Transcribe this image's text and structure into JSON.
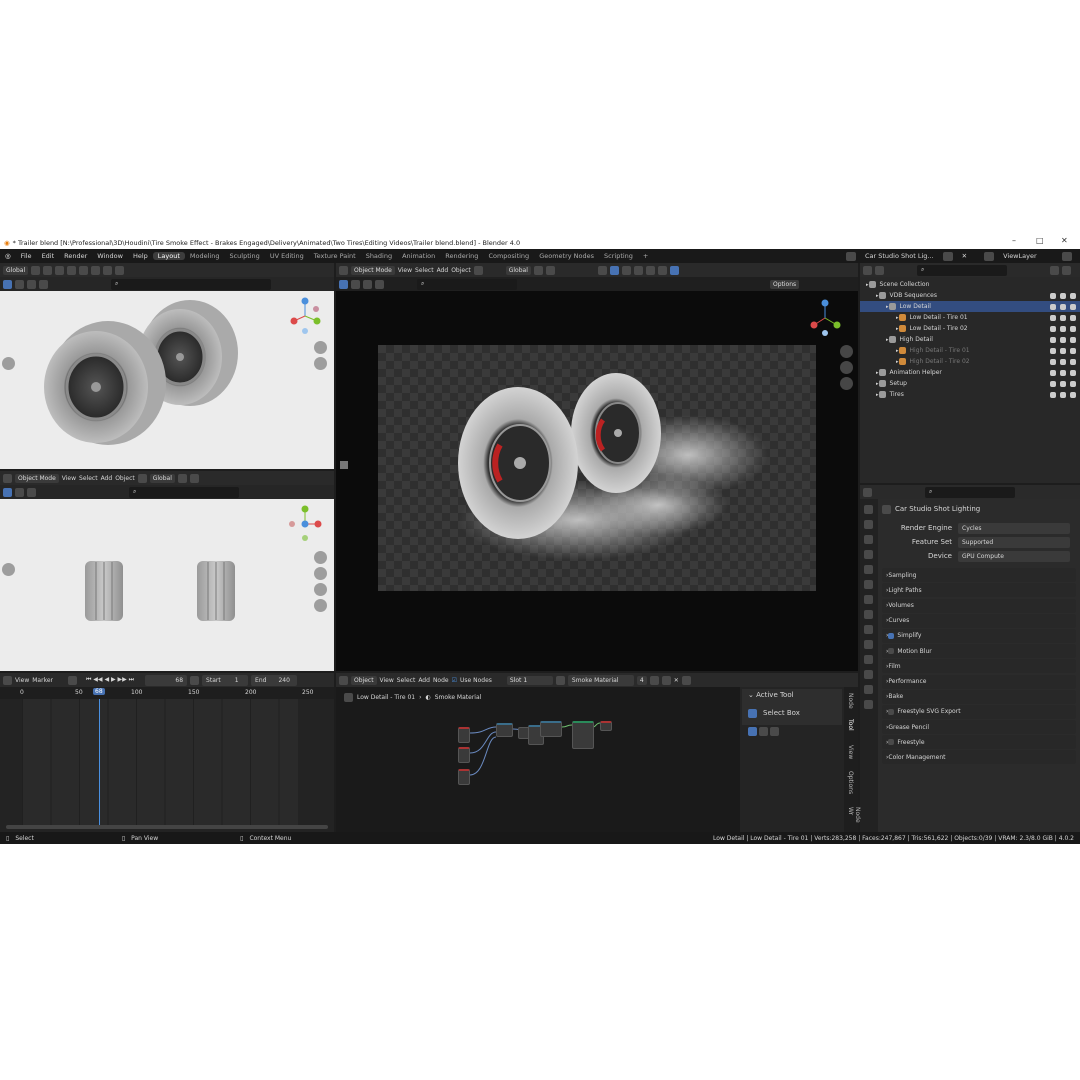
{
  "window": {
    "title": "* Trailer blend [N:\\Professional\\3D\\Houdini\\Tire Smoke Effect - Brakes Engaged\\Delivery\\Animated\\Two Tires\\Editing Videos\\Trailer blend.blend] - Blender 4.0",
    "min": "–",
    "max": "□",
    "close": "✕"
  },
  "menu": [
    "File",
    "Edit",
    "Render",
    "Window",
    "Help"
  ],
  "workspaces": [
    "Layout",
    "Modeling",
    "Sculpting",
    "UV Editing",
    "Texture Paint",
    "Shading",
    "Animation",
    "Rendering",
    "Compositing",
    "Geometry Nodes",
    "Scripting"
  ],
  "workspace_add": "+",
  "scene": {
    "name": "Car Studio Shot Lig...",
    "viewlayer": "ViewLayer"
  },
  "viewport_top_left": {
    "orientation": "Global",
    "icons": [
      "camera-icon",
      "magnet-icon"
    ]
  },
  "viewport_bottom_left": {
    "mode": "Object Mode",
    "menu": [
      "View",
      "Select",
      "Add",
      "Object"
    ],
    "orientation": "Global"
  },
  "viewport_main": {
    "mode": "Object Mode",
    "menu": [
      "View",
      "Select",
      "Add",
      "Object"
    ],
    "orientation": "Global",
    "options": "Options"
  },
  "gizmo": {
    "x": "X",
    "y": "Y",
    "z": "Z"
  },
  "outliner": {
    "rows": [
      {
        "label": "Scene Collection",
        "indent": 0,
        "selected": false,
        "dim": false
      },
      {
        "label": "VDB Sequences",
        "indent": 1,
        "selected": false,
        "dim": false
      },
      {
        "label": "Low Detail",
        "indent": 2,
        "selected": true,
        "dim": false
      },
      {
        "label": "Low Detail - Tire 01",
        "indent": 3,
        "selected": false,
        "dim": false
      },
      {
        "label": "Low Detail - Tire 02",
        "indent": 3,
        "selected": false,
        "dim": false
      },
      {
        "label": "High Detail",
        "indent": 2,
        "selected": false,
        "dim": false
      },
      {
        "label": "High Detail - Tire 01",
        "indent": 3,
        "selected": false,
        "dim": true
      },
      {
        "label": "High Detail - Tire 02",
        "indent": 3,
        "selected": false,
        "dim": true
      },
      {
        "label": "Animation Helper",
        "indent": 1,
        "selected": false,
        "dim": false
      },
      {
        "label": "Setup",
        "indent": 1,
        "selected": false,
        "dim": false
      },
      {
        "label": "Tires",
        "indent": 1,
        "selected": false,
        "dim": false
      }
    ]
  },
  "properties": {
    "scene_name": "Car Studio Shot Lighting",
    "render_engine_label": "Render Engine",
    "render_engine": "Cycles",
    "feature_set_label": "Feature Set",
    "feature_set": "Supported",
    "device_label": "Device",
    "device": "GPU Compute",
    "panels": [
      "Sampling",
      "Light Paths",
      "Volumes",
      "Curves",
      "Simplify",
      "Motion Blur",
      "Film",
      "Performance",
      "Bake",
      "Freestyle SVG Export",
      "Grease Pencil",
      "Freestyle",
      "Color Management"
    ]
  },
  "timeline": {
    "menu": [
      "View",
      "Marker"
    ],
    "current_frame": "68",
    "start_label": "Start",
    "start": "1",
    "end_label": "End",
    "end": "240",
    "ticks": [
      "0",
      "50",
      "68",
      "100",
      "150",
      "200",
      "250"
    ]
  },
  "node_editor": {
    "mode": "Object",
    "menu": [
      "View",
      "Select",
      "Add",
      "Node"
    ],
    "use_nodes": "Use Nodes",
    "slot": "Slot 1",
    "material": "Smoke Material",
    "users": "4",
    "breadcrumb_object": "Low Detail - Tire 01",
    "breadcrumb_material": "Smoke Material",
    "active_tool_header": "Active Tool",
    "active_tool": "Select Box",
    "side_tabs": [
      "Node",
      "Tool",
      "View",
      "Options",
      "Node Wr"
    ]
  },
  "status": {
    "select": "Select",
    "pan": "Pan View",
    "context": "Context Menu",
    "info": "Low Detail | Low Detail - Tire 01 | Verts:283,258 | Faces:247,867 | Tris:561,622 | Objects:0/39 | VRAM: 2.3/8.0 GiB | 4.0.2"
  }
}
